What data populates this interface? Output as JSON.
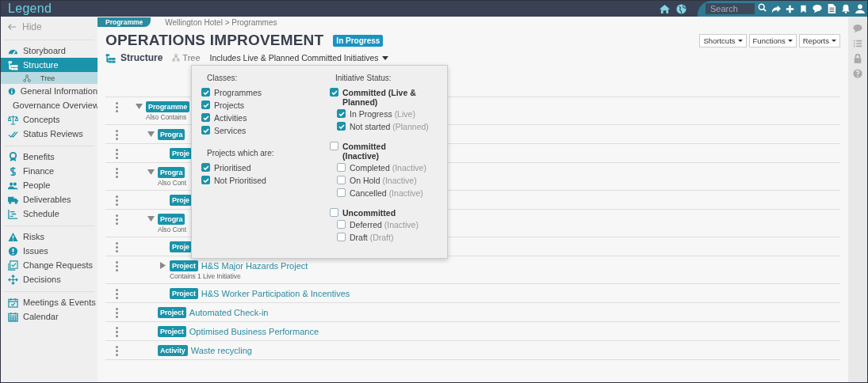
{
  "topbar": {
    "logo": "Legend",
    "search": {
      "placeholder": "Search"
    }
  },
  "sidebar": {
    "hide": "Hide",
    "groups": [
      {
        "items": [
          {
            "label": "Storyboard",
            "selected": false
          },
          {
            "label": "Structure",
            "selected": true,
            "children": [
              {
                "label": "Tree",
                "selected": true
              }
            ]
          },
          {
            "label": "General Information",
            "selected": false
          },
          {
            "label": "Governance Overview",
            "selected": false
          },
          {
            "label": "Concepts",
            "selected": false
          },
          {
            "label": "Status Reviews",
            "selected": false
          }
        ]
      },
      {
        "items": [
          {
            "label": "Benefits",
            "selected": false
          },
          {
            "label": "Finance",
            "selected": false
          },
          {
            "label": "People",
            "selected": false
          },
          {
            "label": "Deliverables",
            "selected": false
          },
          {
            "label": "Schedule",
            "selected": false
          }
        ]
      },
      {
        "items": [
          {
            "label": "Risks",
            "selected": false
          },
          {
            "label": "Issues",
            "selected": false
          },
          {
            "label": "Change Requests",
            "selected": false
          },
          {
            "label": "Decisions",
            "selected": false
          }
        ]
      },
      {
        "items": [
          {
            "label": "Meetings & Events",
            "selected": false
          },
          {
            "label": "Calendar",
            "selected": false
          }
        ]
      }
    ]
  },
  "header": {
    "class_tab": "Programme",
    "breadcrumb": "Wellington Hotel > Programmes",
    "title": "OPERATIONS IMPROVEMENT",
    "status": "In Progress",
    "buttons": [
      "Shortcuts",
      "Functions",
      "Reports"
    ]
  },
  "view_bar": {
    "section": "Structure",
    "view": "Tree",
    "filter": "Includes Live & Planned Committed Initiatives"
  },
  "tree": [
    {
      "badge": "Programme",
      "note": "Also Contains",
      "expanded": true,
      "children": [
        {
          "badge": "Progra",
          "expanded": true,
          "children": [
            {
              "badge": "Proje"
            }
          ]
        },
        {
          "badge": "Progra",
          "note": "Also Cont",
          "expanded": true,
          "children": [
            {
              "badge": "Proje"
            }
          ]
        },
        {
          "badge": "Progra",
          "note": "Also Cont",
          "expanded": true,
          "children": [
            {
              "badge": "Proje"
            },
            {
              "badge": "Project",
              "name": "H&S Major Hazards Project",
              "note": "Contains 1 Live Initiative",
              "expanded": false
            },
            {
              "badge": "Project",
              "name": "H&S Worker Participation & Incentives"
            }
          ]
        },
        {
          "badge": "Project",
          "name": "Automated Check-in"
        },
        {
          "badge": "Project",
          "name": "Optimised Business Performance"
        },
        {
          "badge": "Activity",
          "name": "Waste recycling"
        }
      ]
    }
  ],
  "filter_popup": {
    "classes": {
      "title": "Classes:",
      "items": [
        {
          "label": "Programmes",
          "checked": true
        },
        {
          "label": "Projects",
          "checked": true
        },
        {
          "label": "Activities",
          "checked": true
        },
        {
          "label": "Services",
          "checked": true
        }
      ]
    },
    "projects": {
      "title": "Projects which are:",
      "items": [
        {
          "label": "Prioritised",
          "checked": true
        },
        {
          "label": "Not Prioritised",
          "checked": true
        }
      ]
    },
    "status": {
      "title": "Initiative Status:",
      "groups": [
        {
          "label": "Committed (Live & Planned)",
          "checked": true,
          "items": [
            {
              "label": "In Progress",
              "note": "(Live)",
              "checked": true
            },
            {
              "label": "Not started",
              "note": "(Planned)",
              "checked": true
            }
          ]
        },
        {
          "label": "Committed (Inactive)",
          "checked": false,
          "items": [
            {
              "label": "Completed",
              "note": "(Inactive)",
              "checked": false
            },
            {
              "label": "On Hold",
              "note": "(Inactive)",
              "checked": false
            },
            {
              "label": "Cancelled",
              "note": "(Inactive)",
              "checked": false
            }
          ]
        },
        {
          "label": "Uncommitted",
          "checked": false,
          "items": [
            {
              "label": "Deferred",
              "note": "(Inactive)",
              "checked": false
            },
            {
              "label": "Draft",
              "note": "(Draft)",
              "checked": false
            }
          ]
        }
      ]
    }
  }
}
